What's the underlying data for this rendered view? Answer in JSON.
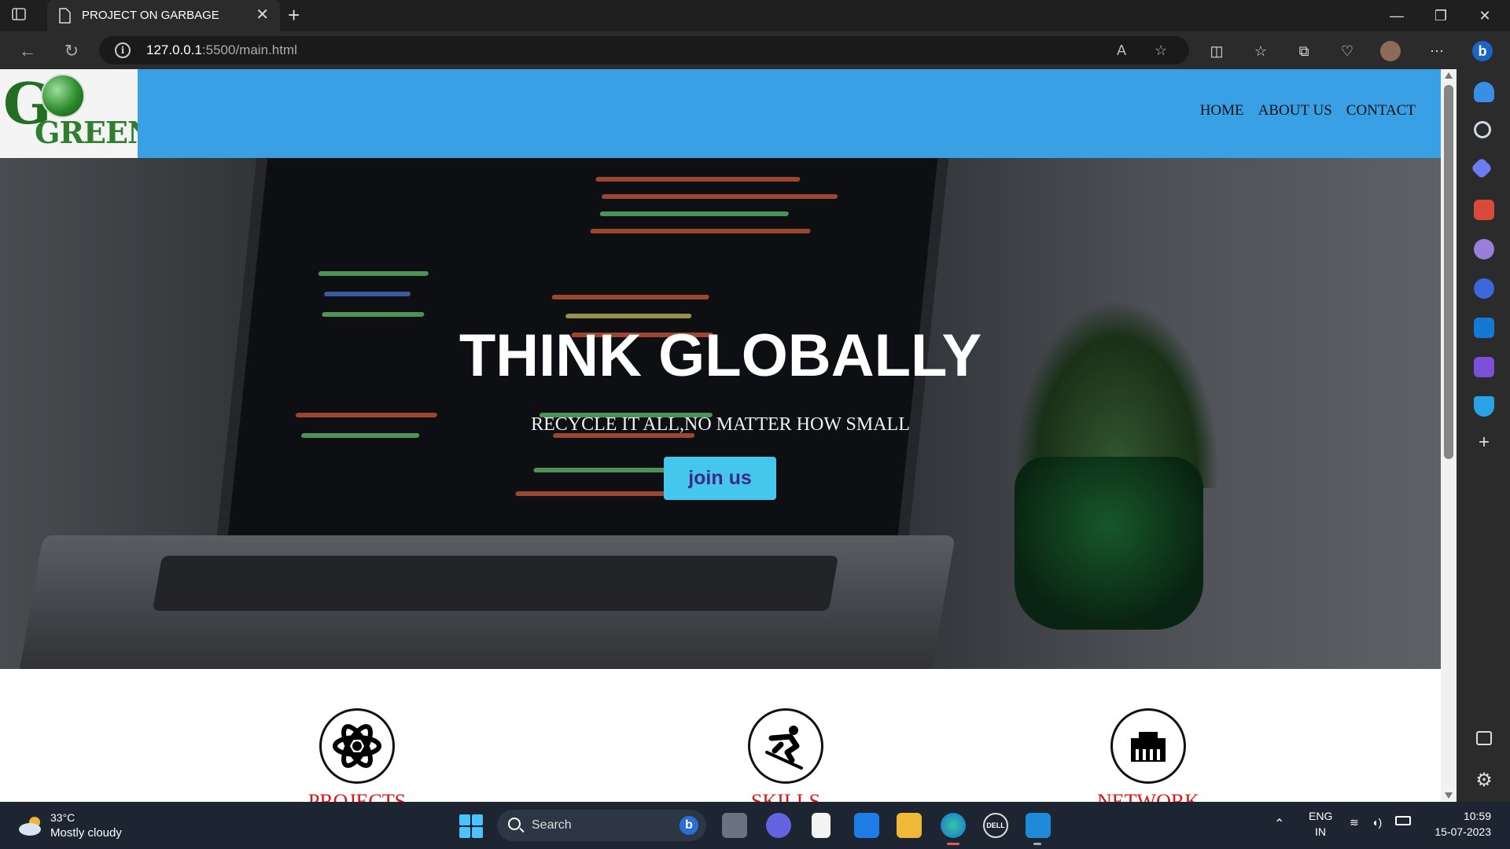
{
  "browser": {
    "tab_title": "PROJECT ON GARBAGE",
    "tab_close": "✕",
    "new_tab": "+",
    "url_host": "127.0.0.1",
    "url_path": ":5500/main.html"
  },
  "site": {
    "logo_letter": "G",
    "logo_word": "GREEN",
    "nav": {
      "home": "HOME",
      "about": "ABOUT US",
      "contact": "CONTACT"
    },
    "hero": {
      "title": "THINK GLOBALLY",
      "subtitle": "RECYCLE IT ALL,NO MATTER HOW SMALL",
      "button": "join us"
    },
    "features": [
      {
        "label": "PROJECTS",
        "icon": "atom-icon"
      },
      {
        "label": "SKILLS",
        "icon": "skier-icon"
      },
      {
        "label": "NETWORK",
        "icon": "ethernet-icon"
      }
    ]
  },
  "taskbar": {
    "temperature": "33°C",
    "weather": "Mostly cloudy",
    "search_label": "Search",
    "lang_top": "ENG",
    "lang_bottom": "IN",
    "time": "10:59",
    "date": "15-07-2023"
  },
  "colors": {
    "header_blue": "#3aa0e5",
    "button_cyan": "#45c6ed",
    "feature_label_red": "#dd1111",
    "taskbar": "#1c2531"
  }
}
